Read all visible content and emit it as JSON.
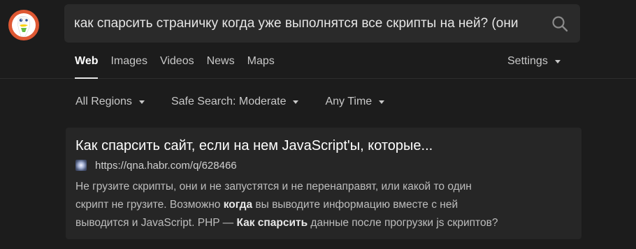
{
  "search": {
    "query": "как спарсить страничку когда уже выполнятся все скрипты на ней? (они",
    "button_icon": "search-icon"
  },
  "logo": {
    "icon": "duckduckgo-logo"
  },
  "tabs": [
    {
      "label": "Web",
      "active": true
    },
    {
      "label": "Images"
    },
    {
      "label": "Videos"
    },
    {
      "label": "News"
    },
    {
      "label": "Maps"
    }
  ],
  "settings": {
    "label": "Settings"
  },
  "filters": [
    {
      "label": "All Regions"
    },
    {
      "label": "Safe Search: Moderate"
    },
    {
      "label": "Any Time"
    }
  ],
  "result": {
    "title": "Как спарсить сайт, если на нем JavaScript'ы, которые...",
    "url": "https://qna.habr.com/q/628466",
    "snippet": {
      "line1": "Не грузите скрипты, они и не запустятся и не перенаправят, или какой то один",
      "line2_a": "скрипт не грузите. Возможно ",
      "line2_b": "когда",
      "line2_c": " вы выводите информацию вместе с ней",
      "line3_a": "выводится и JavaScript. PHP — ",
      "line3_b": "Как спарсить",
      "line3_c": " данные после прогрузки js скриптов?"
    }
  },
  "colors": {
    "background": "#1c1c1c",
    "search_box": "#2a2a2a",
    "result_card": "#262626",
    "logo_orange": "#de5833"
  }
}
